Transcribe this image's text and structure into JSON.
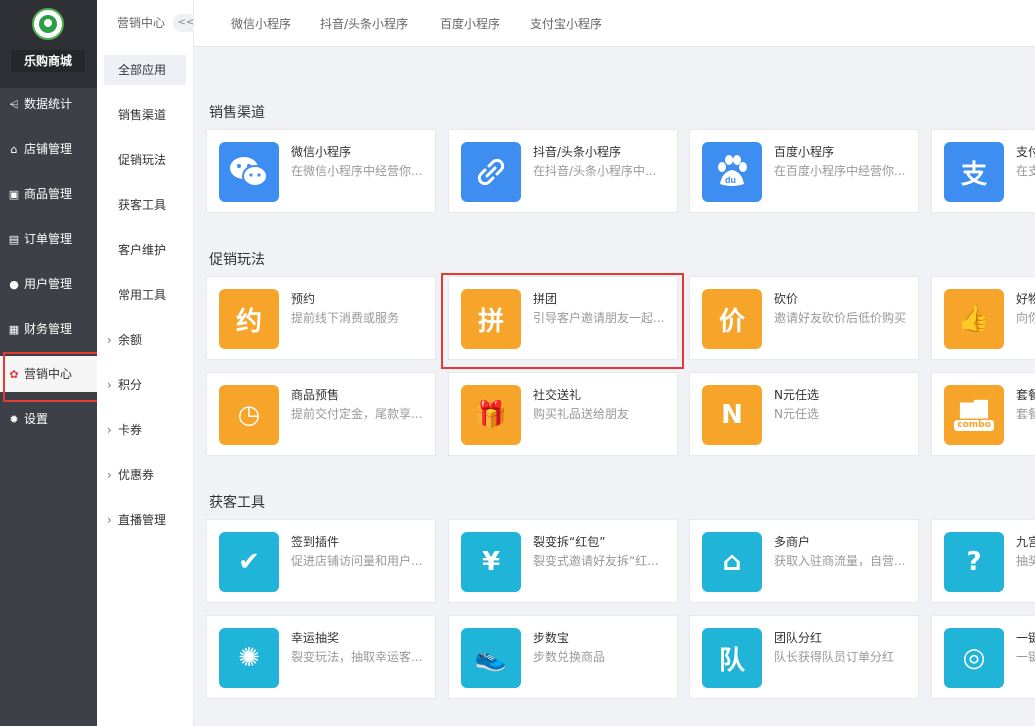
{
  "brand": {
    "name": "乐购商城"
  },
  "colors": {
    "sidebar_bg": "#3e4047",
    "highlight": "#e53935",
    "blue": "#3d8ef0",
    "orange": "#f7a52a",
    "teal": "#1fb4d8"
  },
  "nav": [
    {
      "label": "数据统计",
      "icon": "chart-icon"
    },
    {
      "label": "店铺管理",
      "icon": "store-icon"
    },
    {
      "label": "商品管理",
      "icon": "product-icon"
    },
    {
      "label": "订单管理",
      "icon": "order-icon"
    },
    {
      "label": "用户管理",
      "icon": "user-icon"
    },
    {
      "label": "财务管理",
      "icon": "finance-icon"
    },
    {
      "label": "营销中心",
      "icon": "marketing-icon",
      "active": true
    },
    {
      "label": "设置",
      "icon": "settings-icon"
    }
  ],
  "subnav": {
    "title": "营销中心",
    "collapse": "<<",
    "items": [
      {
        "label": "全部应用",
        "active": true
      },
      {
        "label": "销售渠道"
      },
      {
        "label": "促销玩法"
      },
      {
        "label": "获客工具"
      },
      {
        "label": "客户维护"
      },
      {
        "label": "常用工具"
      },
      {
        "label": "余额",
        "expand": true
      },
      {
        "label": "积分",
        "expand": true
      },
      {
        "label": "卡券",
        "expand": true
      },
      {
        "label": "优惠券",
        "expand": true
      },
      {
        "label": "直播管理",
        "expand": true
      }
    ]
  },
  "tabs": [
    "微信小程序",
    "抖音/头条小程序",
    "百度小程序",
    "支付宝小程序"
  ],
  "sections": [
    {
      "title": "销售渠道",
      "cards": [
        {
          "title": "微信小程序",
          "desc": "在微信小程序中经营你...",
          "icon": "wechat-icon",
          "color": "#3d8ef0"
        },
        {
          "title": "抖音/头条小程序",
          "desc": "在抖音/头条小程序中...",
          "icon": "link-icon",
          "color": "#3d8ef0"
        },
        {
          "title": "百度小程序",
          "desc": "在百度小程序中经营你...",
          "icon": "baidu-icon",
          "color": "#3d8ef0"
        },
        {
          "title": "支付",
          "desc": "在支",
          "icon": "alipay-icon",
          "color": "#3d8ef0"
        }
      ]
    },
    {
      "title": "促销玩法",
      "cards": [
        {
          "title": "预约",
          "desc": "提前线下消费或服务",
          "icon": "reserve-icon",
          "color": "#f7a52a"
        },
        {
          "title": "拼团",
          "desc": "引导客户邀请朋友一起...",
          "icon": "group-buy-icon",
          "color": "#f7a52a"
        },
        {
          "title": "砍价",
          "desc": "邀请好友砍价后低价购买",
          "icon": "bargain-icon",
          "color": "#f7a52a"
        },
        {
          "title": "好物",
          "desc": "向你",
          "icon": "thumbs-up-icon",
          "color": "#f7a52a"
        },
        {
          "title": "商品预售",
          "desc": "提前交付定金，尾款享...",
          "icon": "presale-icon",
          "color": "#f7a52a"
        },
        {
          "title": "社交送礼",
          "desc": "购买礼品送给朋友",
          "icon": "gift-icon",
          "color": "#f7a52a"
        },
        {
          "title": "N元任选",
          "desc": "N元任选",
          "icon": "n-icon",
          "color": "#f7a52a"
        },
        {
          "title": "套餐",
          "desc": "套餐",
          "icon": "combo-icon",
          "color": "#f7a52a"
        }
      ]
    },
    {
      "title": "获客工具",
      "cards": [
        {
          "title": "签到插件",
          "desc": "促进店铺访问量和用户...",
          "icon": "checkin-icon",
          "color": "#1fb4d8"
        },
        {
          "title": "裂变拆“红包”",
          "desc": "裂变式邀请好友拆“红...",
          "icon": "red-packet-icon",
          "color": "#1fb4d8"
        },
        {
          "title": "多商户",
          "desc": "获取入驻商流量，自营...",
          "icon": "merchant-icon",
          "color": "#1fb4d8"
        },
        {
          "title": "九宫",
          "desc": "抽奖",
          "icon": "grid-icon",
          "color": "#1fb4d8"
        },
        {
          "title": "幸运抽奖",
          "desc": "裂变玩法，抽取幸运客...",
          "icon": "wheel-icon",
          "color": "#1fb4d8"
        },
        {
          "title": "步数宝",
          "desc": "步数兑换商品",
          "icon": "shoe-icon",
          "color": "#1fb4d8"
        },
        {
          "title": "团队分红",
          "desc": "队长获得队员订单分红",
          "icon": "team-icon",
          "color": "#1fb4d8"
        },
        {
          "title": "一键",
          "desc": "一键",
          "icon": "aperture-icon",
          "color": "#1fb4d8"
        }
      ]
    }
  ],
  "icon_glyphs": {
    "wechat-icon": "",
    "link-icon": "",
    "baidu-icon": "du",
    "alipay-icon": "支",
    "reserve-icon": "约",
    "group-buy-icon": "拼",
    "bargain-icon": "价",
    "thumbs-up-icon": "👍",
    "presale-icon": "◷",
    "gift-icon": "🎁",
    "n-icon": "N",
    "combo-icon": "combo",
    "checkin-icon": "✔",
    "red-packet-icon": "¥",
    "merchant-icon": "⌂",
    "grid-icon": "?",
    "wheel-icon": "✺",
    "shoe-icon": "👟",
    "team-icon": "队",
    "aperture-icon": "◎"
  }
}
